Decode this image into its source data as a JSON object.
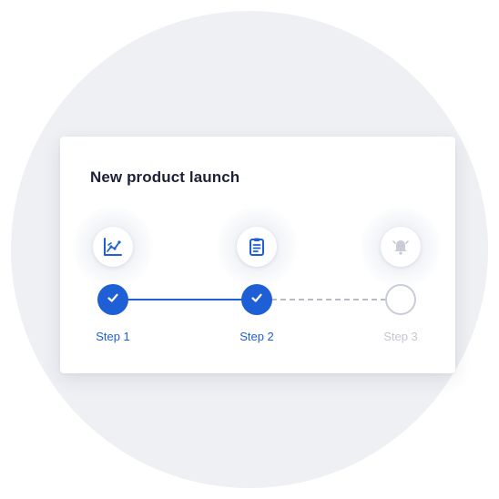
{
  "card": {
    "title": "New product launch"
  },
  "steps": [
    {
      "label": "Step 1",
      "status": "complete",
      "icon": "chart-icon"
    },
    {
      "label": "Step 2",
      "status": "complete",
      "icon": "clipboard-icon"
    },
    {
      "label": "Step 3",
      "status": "pending",
      "icon": "bell-icon"
    }
  ],
  "colors": {
    "accent": "#1f5fd6",
    "pending": "#c9cdd5",
    "title": "#1b2136",
    "background": "#eef0f4"
  }
}
